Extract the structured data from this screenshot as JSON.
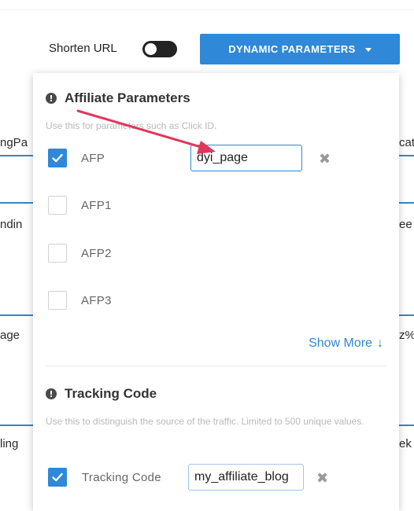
{
  "background_fields": {
    "left": [
      "ngPa",
      "ndin",
      "age",
      "ling"
    ],
    "right": [
      "cat",
      "ee",
      "z%",
      "ek"
    ]
  },
  "toolbar": {
    "shorten_label": "Shorten URL",
    "shorten_toggle_on": false,
    "dynamic_button_label": "DYNAMIC PARAMETERS"
  },
  "affiliate": {
    "title": "Affiliate Parameters",
    "hint": "Use this for parameters such as Click ID.",
    "rows": [
      {
        "label": "AFP",
        "checked": true,
        "value": "dyi_page"
      },
      {
        "label": "AFP1",
        "checked": false
      },
      {
        "label": "AFP2",
        "checked": false
      },
      {
        "label": "AFP3",
        "checked": false
      }
    ],
    "show_more_label": "Show More",
    "show_more_icon": "↓"
  },
  "tracking": {
    "title": "Tracking Code",
    "hint": "Use this to distinguish the source of the traffic. Limited to 500 unique values.",
    "row": {
      "label": "Tracking Code",
      "checked": true,
      "value": "my_affiliate_blog"
    }
  },
  "colors": {
    "accent": "#2f88d8",
    "annotation_arrow": "#e0365a"
  },
  "icons": {
    "info": "info-circle-icon",
    "clear": "close-x-icon",
    "check": "checkmark-icon",
    "caret": "caret-down-icon",
    "arrow": "annotation-arrow-icon"
  }
}
